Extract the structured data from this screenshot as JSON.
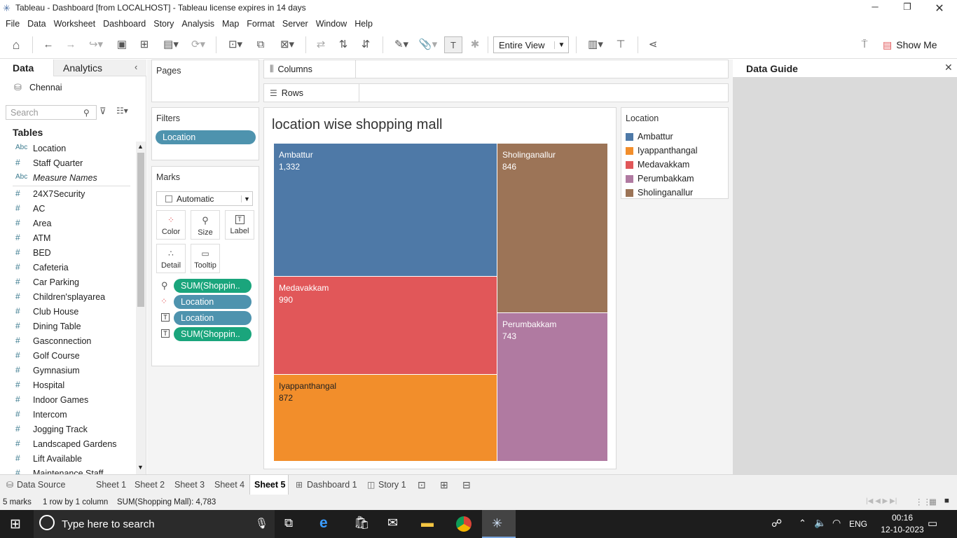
{
  "window": {
    "title": "Tableau - Dashboard [from LOCALHOST] - Tableau license expires in 14 days"
  },
  "menu": [
    "File",
    "Data",
    "Worksheet",
    "Dashboard",
    "Story",
    "Analysis",
    "Map",
    "Format",
    "Server",
    "Window",
    "Help"
  ],
  "toolbar": {
    "fit": "Entire View",
    "show_me": "Show Me"
  },
  "left": {
    "tab_data": "Data",
    "tab_analytics": "Analytics",
    "datasource": "Chennai",
    "search_placeholder": "Search",
    "tables_label": "Tables",
    "fields": [
      {
        "type": "Abc",
        "name": "Location"
      },
      {
        "type": "#",
        "name": "Staff Quarter"
      },
      {
        "type": "Abc",
        "name": "Measure Names"
      },
      {
        "type": "#",
        "name": "24X7Security"
      },
      {
        "type": "#",
        "name": "AC"
      },
      {
        "type": "#",
        "name": "Area"
      },
      {
        "type": "#",
        "name": "ATM"
      },
      {
        "type": "#",
        "name": "BED"
      },
      {
        "type": "#",
        "name": "Cafeteria"
      },
      {
        "type": "#",
        "name": "Car Parking"
      },
      {
        "type": "#",
        "name": "Children'splayarea"
      },
      {
        "type": "#",
        "name": "Club House"
      },
      {
        "type": "#",
        "name": "Dining Table"
      },
      {
        "type": "#",
        "name": "Gasconnection"
      },
      {
        "type": "#",
        "name": "Golf Course"
      },
      {
        "type": "#",
        "name": "Gymnasium"
      },
      {
        "type": "#",
        "name": "Hospital"
      },
      {
        "type": "#",
        "name": "Indoor Games"
      },
      {
        "type": "#",
        "name": "Intercom"
      },
      {
        "type": "#",
        "name": "Jogging Track"
      },
      {
        "type": "#",
        "name": "Landscaped Gardens"
      },
      {
        "type": "#",
        "name": "Lift Available"
      },
      {
        "type": "#",
        "name": "Maintenance Staff"
      }
    ]
  },
  "shelves": {
    "pages": "Pages",
    "filters": "Filters",
    "filter_pill": "Location",
    "marks": "Marks",
    "mark_type": "Automatic",
    "mark_buttons": [
      "Color",
      "Size",
      "Label",
      "Detail",
      "Tooltip"
    ],
    "mark_pills": [
      {
        "label": "SUM(Shoppin..",
        "color": "#1aa57c"
      },
      {
        "label": "Location",
        "color": "#4e93ae"
      },
      {
        "label": "Location",
        "color": "#4e93ae"
      },
      {
        "label": "SUM(Shoppin..",
        "color": "#1aa57c"
      }
    ],
    "columns": "Columns",
    "rows": "Rows"
  },
  "viz": {
    "title": "location wise shopping mall"
  },
  "chart_data": {
    "type": "treemap",
    "title": "location wise shopping mall",
    "measure": "SUM(Shopping Mall)",
    "categories": [
      "Ambattur",
      "Sholinganallur",
      "Medavakkam",
      "Iyappanthangal",
      "Perumbakkam"
    ],
    "values": [
      1332,
      846,
      990,
      872,
      743
    ],
    "colors": [
      "#4e79a7",
      "#9c7457",
      "#e15759",
      "#f28e2b",
      "#b07aa1"
    ],
    "value_labels": [
      "1,332",
      "846",
      "990",
      "872",
      "743"
    ],
    "label_colors": [
      "#ffffff",
      "#ffffff",
      "#ffffff",
      "#222222",
      "#ffffff"
    ]
  },
  "legend": {
    "title": "Location",
    "items": [
      {
        "name": "Ambattur",
        "color": "#4e79a7"
      },
      {
        "name": "Iyappanthangal",
        "color": "#f28e2b"
      },
      {
        "name": "Medavakkam",
        "color": "#e15759"
      },
      {
        "name": "Perumbakkam",
        "color": "#b07aa1"
      },
      {
        "name": "Sholinganallur",
        "color": "#9c7457"
      }
    ]
  },
  "guide": {
    "title": "Data Guide"
  },
  "tabs": {
    "datasource": "Data Source",
    "sheets": [
      "Sheet 1",
      "Sheet 2",
      "Sheet 3",
      "Sheet 4",
      "Sheet 5"
    ],
    "active": "Sheet 5",
    "dashboard": "Dashboard 1",
    "story": "Story 1"
  },
  "status": {
    "marks": "5 marks",
    "rowscols": "1 row by 1 column",
    "sum": "SUM(Shopping Mall): 4,783"
  },
  "taskbar": {
    "search": "Type here to search",
    "lang": "ENG",
    "time": "00:16",
    "date": "12-10-2023"
  }
}
